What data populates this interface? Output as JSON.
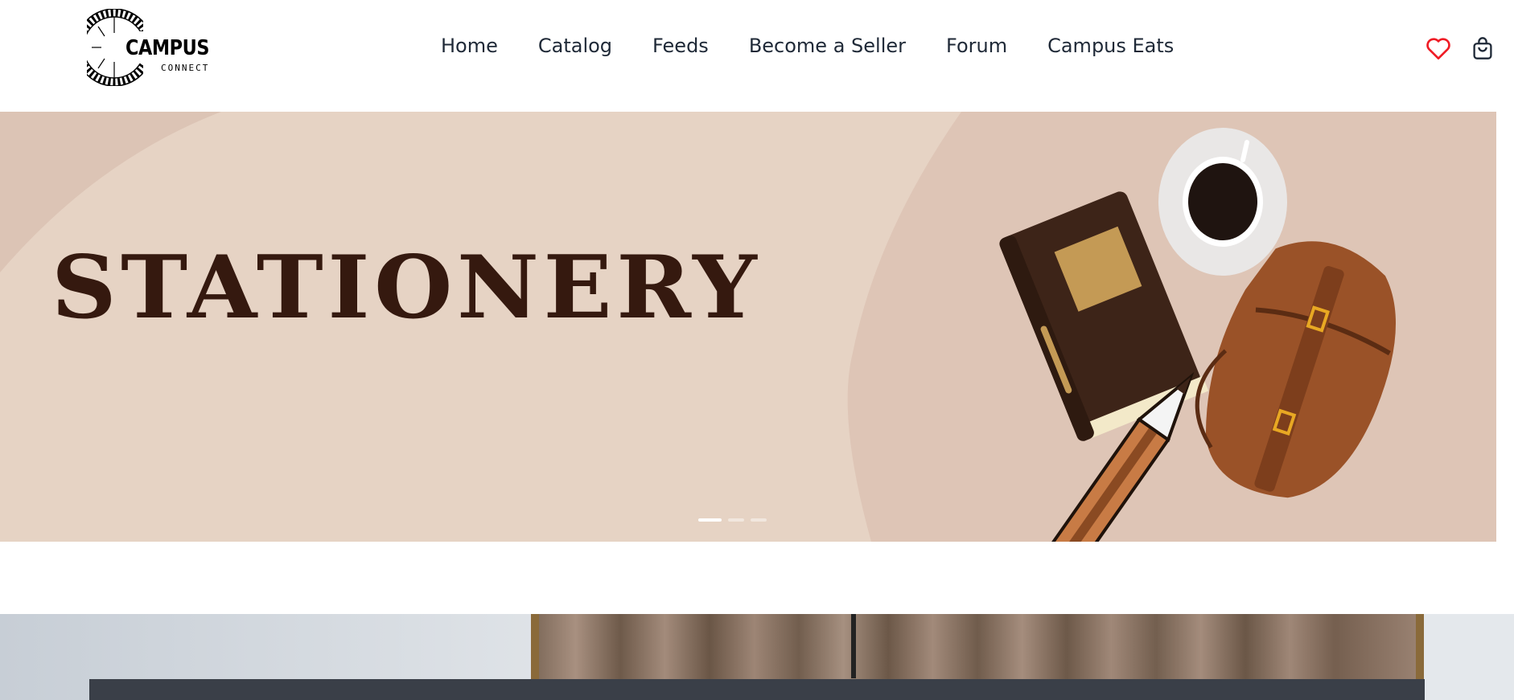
{
  "logo": {
    "word": "CAMPUS",
    "sub": "CONNECT"
  },
  "nav": {
    "items": [
      {
        "label": "Home"
      },
      {
        "label": "Catalog"
      },
      {
        "label": "Feeds"
      },
      {
        "label": "Become a Seller"
      },
      {
        "label": "Forum"
      },
      {
        "label": "Campus Eats"
      }
    ]
  },
  "actions": {
    "wishlist_icon": "heart-icon",
    "cart_icon": "shopping-bag-icon",
    "wishlist_color": "#ef1c25"
  },
  "hero": {
    "title": "STATIONERY",
    "slides": 3,
    "active_slide": 1,
    "background_color": "#e6d3c4",
    "title_color": "#35190f"
  }
}
